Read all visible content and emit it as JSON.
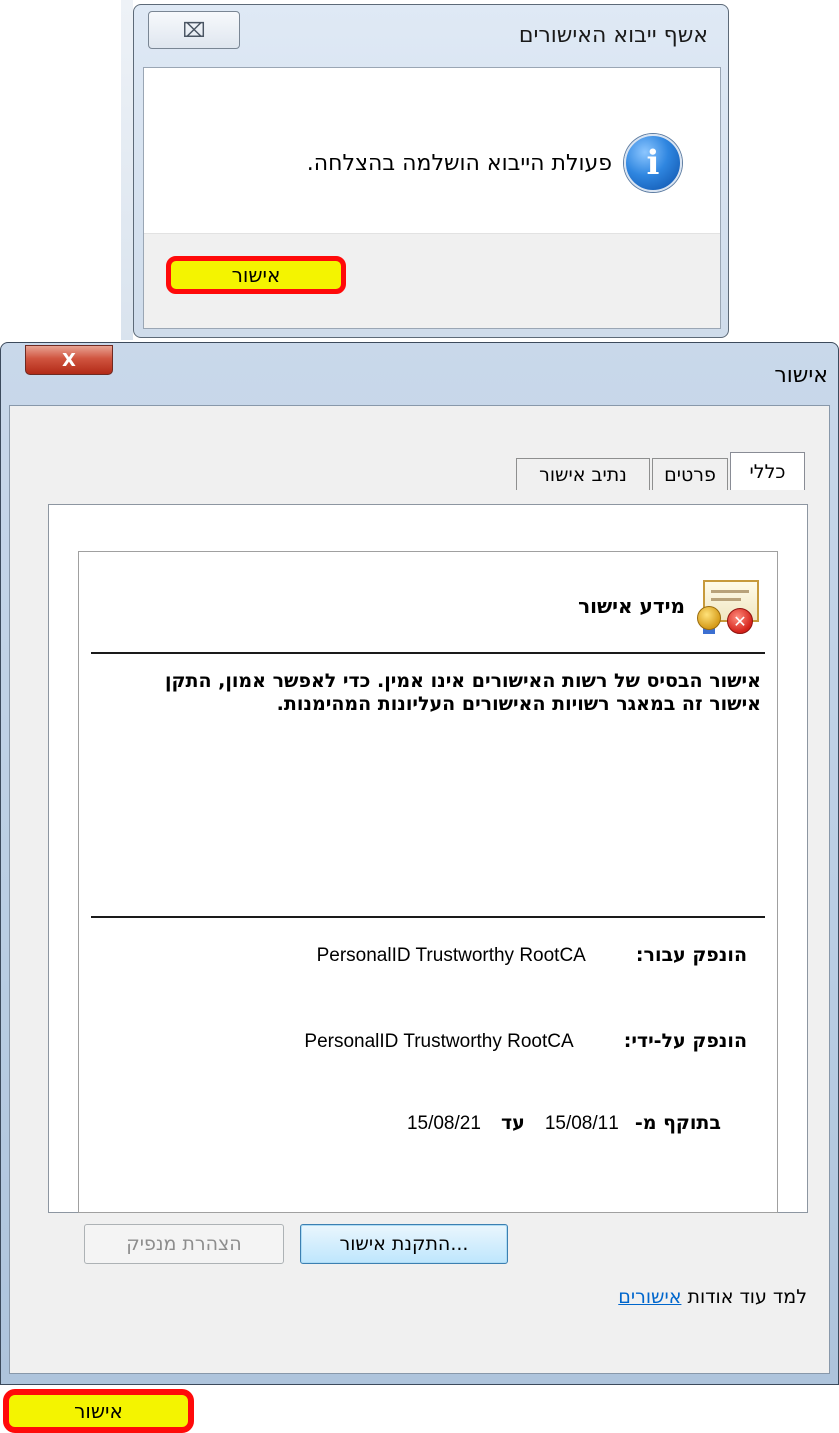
{
  "import_wizard": {
    "title": "אשף ייבוא האישורים",
    "close_symbol": "⌧",
    "message": "פעולת הייבוא הושלמה בהצלחה.",
    "info_icon_glyph": "i",
    "ok_label": "אישור"
  },
  "certificate_dialog": {
    "title": "אישור",
    "close_symbol": "X",
    "tabs": [
      {
        "label": "כללי",
        "active": true
      },
      {
        "label": "פרטים",
        "active": false
      },
      {
        "label": "נתיב אישור",
        "active": false
      }
    ],
    "info_title": "מידע אישור",
    "warning": "אישור הבסיס של רשות האישורים אינו אמין. כדי לאפשר אמון, התקן אישור זה במאגר רשויות האישורים העליונות המהימנות.",
    "issued_to_label": "הונפק עבור:",
    "issued_to_value": "PersonalID Trustworthy RootCA",
    "issued_by_label": "הונפק על-ידי:",
    "issued_by_value": "PersonalID Trustworthy RootCA",
    "valid_from_label": "בתוקף מ-",
    "valid_from_value": "15/08/11",
    "valid_to_label": "עד",
    "valid_to_value": "15/08/21",
    "install_button": "התקנת אישור...",
    "issuer_statement_button": "הצהרת מנפיק",
    "learn_more_prefix": "למד עוד אודות",
    "learn_more_link": "אישורים",
    "ok_label": "אישור"
  },
  "colors": {
    "highlight_fill": "#f4f400",
    "highlight_border": "#ff0a0a",
    "link": "#0066cc"
  }
}
